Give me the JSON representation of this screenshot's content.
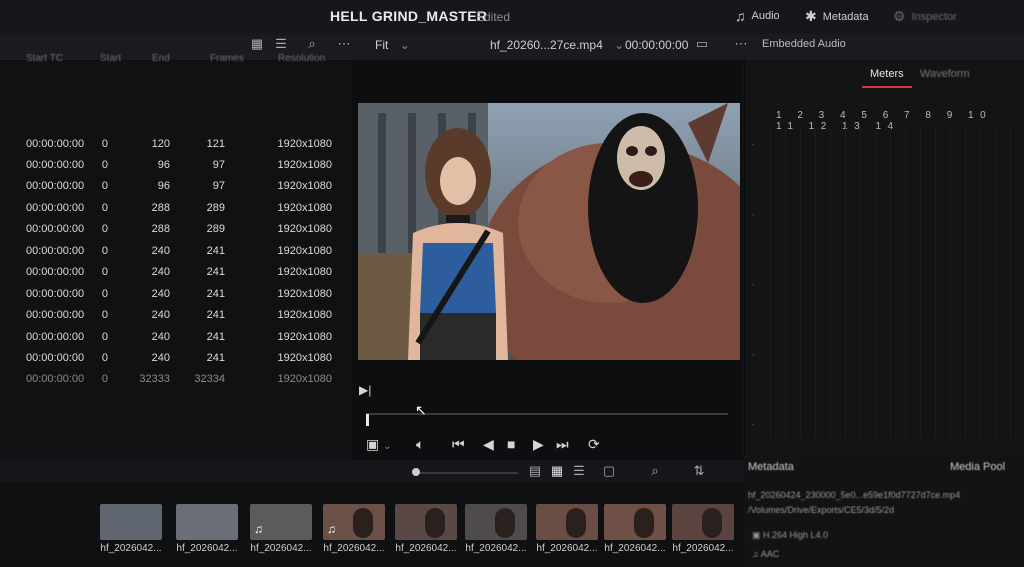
{
  "header": {
    "project_name": "HELL GRIND_MASTER",
    "status": "Edited",
    "right_items": [
      {
        "label": "Audio",
        "icon": "music-note-icon"
      },
      {
        "label": "Metadata",
        "icon": "metadata-icon"
      },
      {
        "label": "Inspector",
        "icon": "inspector-icon"
      }
    ]
  },
  "toolbar": {
    "zoom": "Fit",
    "clip_name": "hf_20260...27ce.mp4",
    "timecode": "00:00:00:00",
    "audio_label": "Embedded Audio"
  },
  "media_pool": {
    "columns": [
      "Start TC",
      "Start",
      "End",
      "Frames",
      "Resolution"
    ],
    "rows": [
      {
        "tc": "00:00:00:00",
        "start": "0",
        "end": "120",
        "frames": "121",
        "res": "1920x1080"
      },
      {
        "tc": "00:00:00:00",
        "start": "0",
        "end": "96",
        "frames": "97",
        "res": "1920x1080"
      },
      {
        "tc": "00:00:00:00",
        "start": "0",
        "end": "96",
        "frames": "97",
        "res": "1920x1080"
      },
      {
        "tc": "00:00:00:00",
        "start": "0",
        "end": "288",
        "frames": "289",
        "res": "1920x1080"
      },
      {
        "tc": "00:00:00:00",
        "start": "0",
        "end": "288",
        "frames": "289",
        "res": "1920x1080"
      },
      {
        "tc": "00:00:00:00",
        "start": "0",
        "end": "240",
        "frames": "241",
        "res": "1920x1080"
      },
      {
        "tc": "00:00:00:00",
        "start": "0",
        "end": "240",
        "frames": "241",
        "res": "1920x1080"
      },
      {
        "tc": "00:00:00:00",
        "start": "0",
        "end": "240",
        "frames": "241",
        "res": "1920x1080"
      },
      {
        "tc": "00:00:00:00",
        "start": "0",
        "end": "240",
        "frames": "241",
        "res": "1920x1080"
      },
      {
        "tc": "00:00:00:00",
        "start": "0",
        "end": "240",
        "frames": "241",
        "res": "1920x1080"
      },
      {
        "tc": "00:00:00:00",
        "start": "0",
        "end": "240",
        "frames": "241",
        "res": "1920x1080"
      },
      {
        "tc": "00:00:00:00",
        "start": "0",
        "end": "32333",
        "frames": "32334",
        "res": "1920x1080"
      }
    ]
  },
  "right_panel": {
    "tabs": [
      "Meters",
      "Waveform"
    ],
    "channels": "1 2 3 4 5 6 7 8 9 10 11 12 13 14"
  },
  "thumbnails": [
    {
      "label": "hf_2026042..."
    },
    {
      "label": "hf_2026042..."
    },
    {
      "label": "hf_2026042..."
    },
    {
      "label": "hf_2026042..."
    },
    {
      "label": "hf_2026042..."
    },
    {
      "label": "hf_2026042..."
    },
    {
      "label": "hf_2026042..."
    },
    {
      "label": "hf_2026042..."
    },
    {
      "label": "hf_2026042..."
    }
  ],
  "metadata_panel": {
    "title": "Metadata",
    "right_label": "Media Pool",
    "filename": "hf_20260424_230000_5e0...e59e1f0d7727d7ce.mp4",
    "line2": "/Volumes/Drive/Exports/CE5/3d/5/2d",
    "codec": "H.264 High L4.0",
    "audio_codec": "AAC"
  },
  "colors": {
    "accent_red": "#d33b3b",
    "background": "#111214",
    "panel": "#16171a"
  }
}
